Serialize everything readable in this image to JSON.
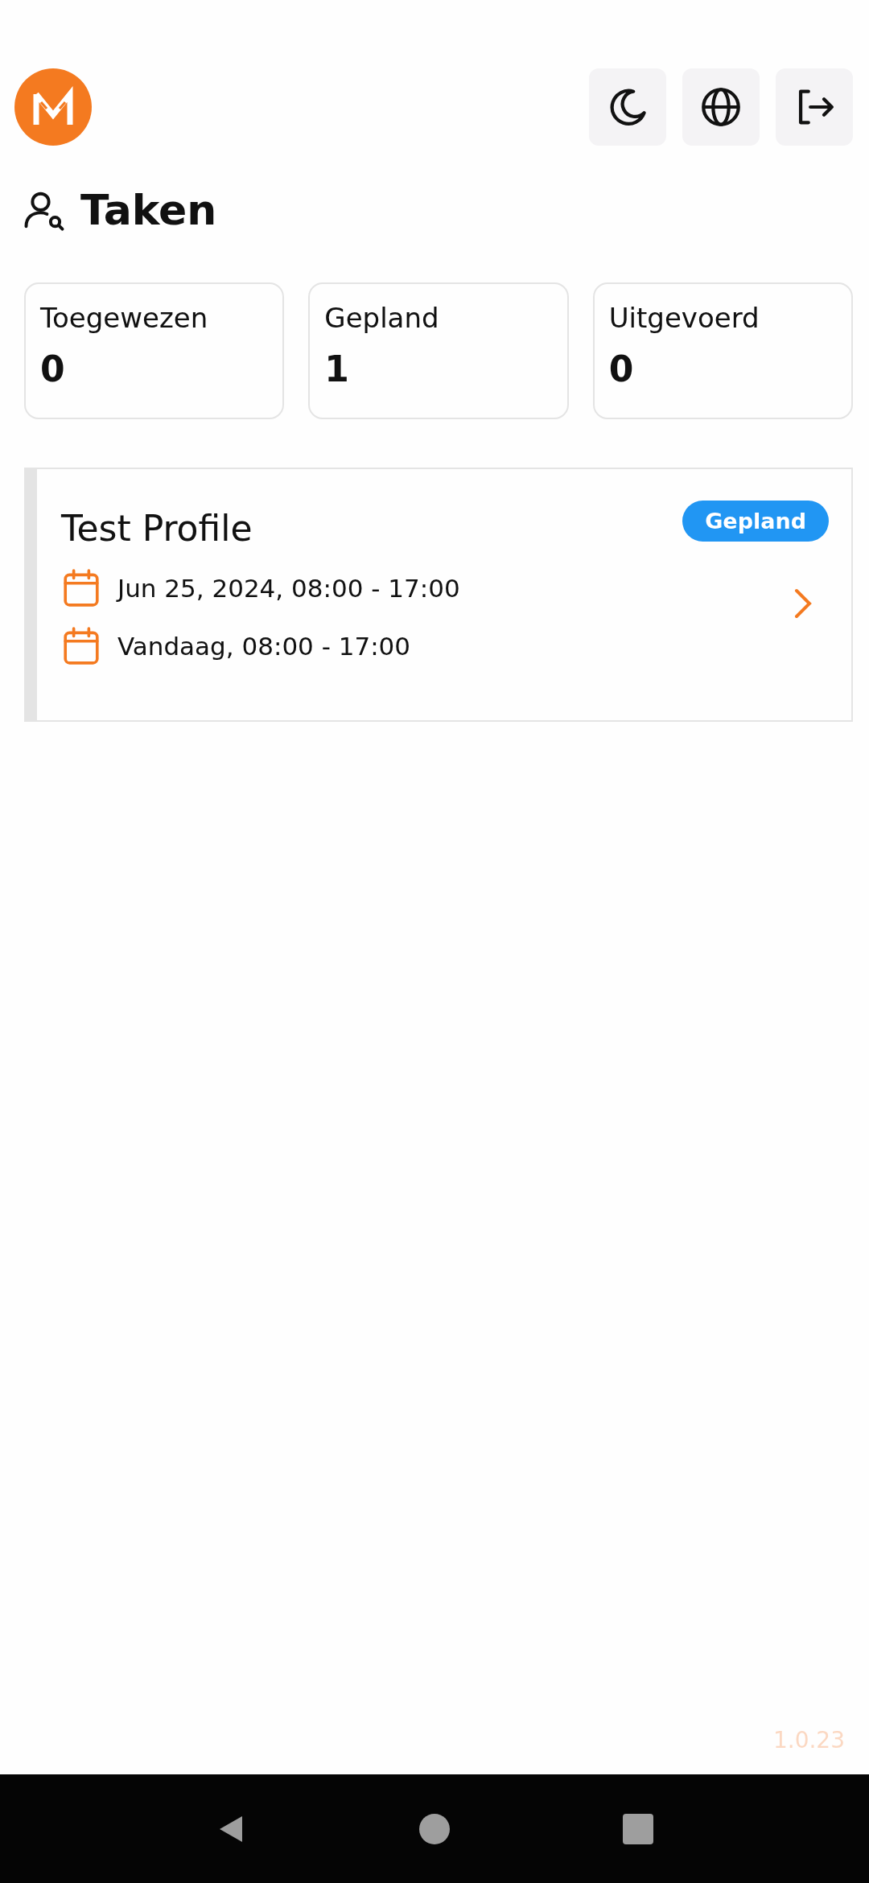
{
  "header": {
    "actions": [
      {
        "kind": "theme"
      },
      {
        "kind": "language"
      },
      {
        "kind": "logout"
      }
    ]
  },
  "page_title": "Taken",
  "stats": [
    {
      "label": "Toegewezen",
      "count": "0"
    },
    {
      "label": "Gepland",
      "count": "1"
    },
    {
      "label": "Uitgevoerd",
      "count": "0"
    }
  ],
  "tasks": [
    {
      "title": "Test Profile",
      "status": "Gepland",
      "color": "#2196f3",
      "dates": [
        "Jun 25, 2024, 08:00 - 17:00",
        "Vandaag, 08:00 - 17:00"
      ]
    }
  ],
  "version": "1.0.23"
}
